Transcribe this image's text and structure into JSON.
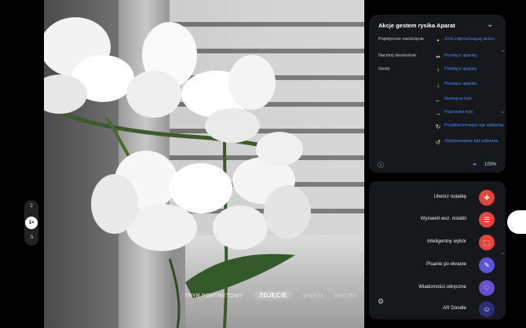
{
  "zoom": {
    "options": [
      "2",
      "1×",
      ".5"
    ]
  },
  "camera_modes": {
    "portrait": "TRYB PORTRETOWY",
    "photo": "ZDJĘCIE",
    "video": "WIDEO",
    "more": "WIĘCEJ"
  },
  "gesture_panel": {
    "title": "Akcje gestem rysika Aparat",
    "rows": [
      {
        "label": "Pojedyncze naciśnięcie",
        "icon": "single-dot",
        "glyph": "•",
        "action": "Zrób zdjęcie/nagraj wideo"
      },
      {
        "label": "Naciśnij dwukrotnie",
        "icon": "double-dot",
        "glyph": "••",
        "action": "Przełącz aparaty"
      },
      {
        "label": "Gesty",
        "icon": "arrow-up",
        "glyph": "↑",
        "action": "Przełącz aparaty"
      },
      {
        "label": "",
        "icon": "arrow-down",
        "glyph": "↓",
        "action": "Przełącz aparaty"
      },
      {
        "label": "",
        "icon": "arrow-left",
        "glyph": "←",
        "action": "Następny tryb"
      },
      {
        "label": "",
        "icon": "arrow-right",
        "glyph": "→",
        "action": "Poprzedni tryb"
      },
      {
        "label": "",
        "icon": "rotate-cw",
        "glyph": "↻",
        "action": "Przybliż/zmniejsz kąt widzenia"
      },
      {
        "label": "",
        "icon": "rotate-ccw",
        "glyph": "↺",
        "action": "Oddal/zwiększ kąt widzenia"
      }
    ],
    "battery": "100%"
  },
  "air_command": {
    "items": [
      {
        "label": "Utwórz notatkę",
        "icon": "note-add",
        "color": "#e6453d",
        "glyph": "✚"
      },
      {
        "label": "Wyświetl wsz. notatki",
        "icon": "notes-list",
        "color": "#e6453d",
        "glyph": "☰"
      },
      {
        "label": "Inteligentny wybór",
        "icon": "smart-select",
        "color": "#e6453d",
        "glyph": "⬚"
      },
      {
        "label": "Pisanie po ekranie",
        "icon": "screen-write",
        "color": "#5a55d6",
        "glyph": "✎"
      },
      {
        "label": "Wiadomości odręczne",
        "icon": "live-message",
        "color": "#6a4ed0",
        "glyph": "♡"
      },
      {
        "label": "AR Doodle",
        "icon": "ar-doodle",
        "color": "#2e2f7a",
        "glyph": "☺"
      }
    ]
  }
}
